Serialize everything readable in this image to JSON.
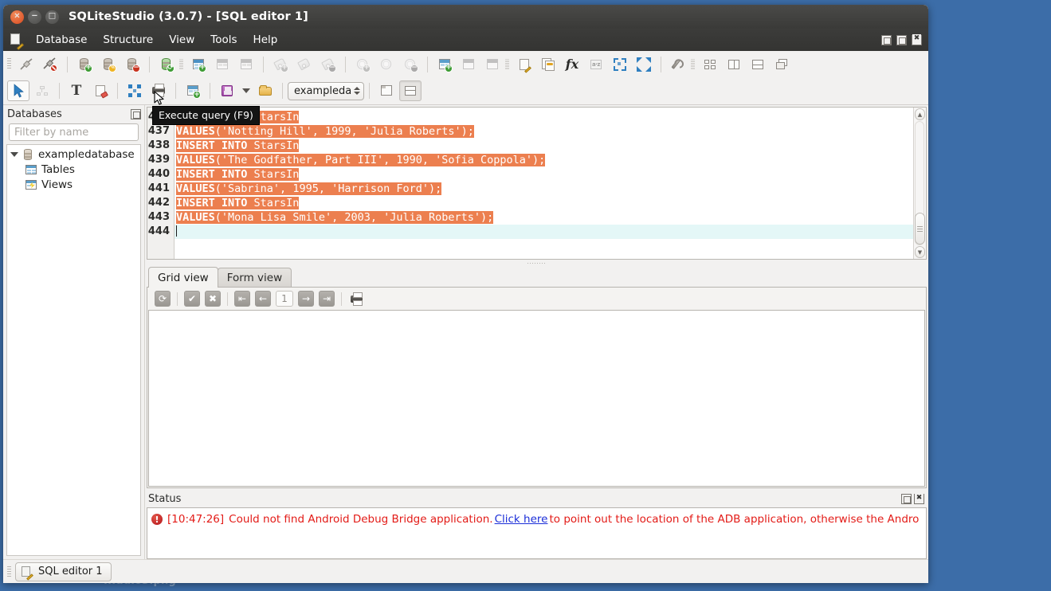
{
  "desktop": {
    "background_color": "#3c6da8",
    "partial_text": "...udio3.png"
  },
  "window": {
    "title": "SQLiteStudio (3.0.7) - [SQL editor 1]",
    "controls": {
      "close": "×",
      "minimize": "−",
      "maximize": "□"
    }
  },
  "menubar": {
    "app_icon": "sql-editor-icon",
    "items": [
      {
        "label": "Database"
      },
      {
        "label": "Structure"
      },
      {
        "label": "View"
      },
      {
        "label": "Tools"
      },
      {
        "label": "Help"
      }
    ]
  },
  "mdi_controls": {
    "minimize": "minimize-icon",
    "restore": "restore-icon",
    "close": "close-icon"
  },
  "toolbar_main": [
    {
      "name": "connect-database",
      "icon": "plug-icon"
    },
    {
      "name": "disconnect-database",
      "icon": "plug-disconnect-icon"
    },
    {
      "name": "add-database",
      "icon": "database-add-icon"
    },
    {
      "name": "edit-database",
      "icon": "database-edit-icon"
    },
    {
      "name": "remove-database",
      "icon": "database-remove-icon"
    },
    {
      "name": "refresh-database",
      "icon": "database-refresh-icon"
    },
    {
      "name": "create-table",
      "icon": "table-add-icon"
    },
    {
      "name": "edit-table",
      "icon": "table-edit-icon"
    },
    {
      "name": "delete-table",
      "icon": "table-remove-icon"
    },
    {
      "name": "create-index",
      "icon": "index-add-icon"
    },
    {
      "name": "edit-index",
      "icon": "index-edit-icon"
    },
    {
      "name": "delete-index",
      "icon": "index-remove-icon"
    },
    {
      "name": "create-trigger",
      "icon": "trigger-add-icon"
    },
    {
      "name": "edit-trigger",
      "icon": "trigger-edit-icon"
    },
    {
      "name": "delete-trigger",
      "icon": "trigger-remove-icon"
    },
    {
      "name": "create-view",
      "icon": "view-add-icon"
    },
    {
      "name": "edit-view",
      "icon": "view-edit-icon"
    },
    {
      "name": "delete-view",
      "icon": "view-remove-icon"
    },
    {
      "name": "open-sql-editor",
      "icon": "sql-editor-icon"
    },
    {
      "name": "open-ddl-history",
      "icon": "ddl-history-icon"
    },
    {
      "name": "open-function-editor",
      "icon": "function-fx-icon"
    },
    {
      "name": "open-collation-editor",
      "icon": "collation-az-icon"
    },
    {
      "name": "import-data",
      "icon": "arrows-in-icon"
    },
    {
      "name": "export-data",
      "icon": "arrows-out-icon"
    },
    {
      "name": "open-configuration",
      "icon": "wrench-icon"
    },
    {
      "name": "tile-windows",
      "icon": "tile-grid-icon"
    },
    {
      "name": "tile-vertically",
      "icon": "tile-vertical-icon"
    },
    {
      "name": "tile-horizontally",
      "icon": "tile-horizontal-icon"
    },
    {
      "name": "cascade-windows",
      "icon": "cascade-icon"
    }
  ],
  "toolbar_editor": {
    "buttons": [
      {
        "name": "execute-query",
        "icon": "blue-arrow-icon",
        "pressed": true
      },
      {
        "name": "explain-query-plan",
        "icon": "sitemap-icon"
      },
      {
        "name": "format-sql",
        "icon": "text-T-icon"
      },
      {
        "name": "clear-editor",
        "icon": "page-erase-icon"
      },
      {
        "name": "expand-query",
        "icon": "blue-expand-icon"
      },
      {
        "name": "print-results",
        "icon": "printer-icon"
      },
      {
        "name": "export-results",
        "icon": "export-grid-icon"
      },
      {
        "name": "save-sql-file",
        "icon": "floppy-save-icon"
      },
      {
        "name": "save-dropdown",
        "icon": "chevron-down-icon"
      },
      {
        "name": "open-sql-file",
        "icon": "folder-open-icon"
      },
      {
        "name": "results-in-tab",
        "icon": "window-tab-icon"
      },
      {
        "name": "results-below",
        "icon": "window-split-icon",
        "pressed": true
      }
    ],
    "database_selector": {
      "value": "exampleda",
      "name": "database-combobox"
    }
  },
  "tooltip": {
    "text": "Execute query (F9)"
  },
  "sidebar": {
    "title": "Databases",
    "dock_buttons": [
      "float-icon"
    ],
    "filter": {
      "placeholder": "Filter by name",
      "value": ""
    },
    "tree": [
      {
        "label": "exampledatabase",
        "icon": "database-icon",
        "level": 0,
        "expanded": true
      },
      {
        "label": "Tables",
        "icon": "tables-icon",
        "level": 1
      },
      {
        "label": "Views",
        "icon": "views-icon",
        "level": 1
      }
    ]
  },
  "editor": {
    "first_line_number": 436,
    "lines": [
      {
        "n": 436,
        "segments": [
          {
            "t": "INSERT INTO",
            "k": true
          },
          {
            "t": " StarsIn",
            "k": false
          }
        ],
        "selected": true
      },
      {
        "n": 437,
        "segments": [
          {
            "t": "VALUES",
            "k": true
          },
          {
            "t": "('Notting Hill', 1999, 'Julia Roberts');",
            "k": false
          }
        ],
        "selected": true
      },
      {
        "n": 438,
        "segments": [
          {
            "t": "INSERT INTO",
            "k": true
          },
          {
            "t": " StarsIn",
            "k": false
          }
        ],
        "selected": true
      },
      {
        "n": 439,
        "segments": [
          {
            "t": "VALUES",
            "k": true
          },
          {
            "t": "('The Godfather, Part III', 1990, 'Sofia Coppola');",
            "k": false
          }
        ],
        "selected": true
      },
      {
        "n": 440,
        "segments": [
          {
            "t": "INSERT INTO",
            "k": true
          },
          {
            "t": " StarsIn",
            "k": false
          }
        ],
        "selected": true
      },
      {
        "n": 441,
        "segments": [
          {
            "t": "VALUES",
            "k": true
          },
          {
            "t": "('Sabrina', 1995, 'Harrison Ford');",
            "k": false
          }
        ],
        "selected": true
      },
      {
        "n": 442,
        "segments": [
          {
            "t": "INSERT INTO",
            "k": true
          },
          {
            "t": " StarsIn",
            "k": false
          }
        ],
        "selected": true
      },
      {
        "n": 443,
        "segments": [
          {
            "t": "VALUES",
            "k": true
          },
          {
            "t": "('Mona Lisa Smile', 2003, 'Julia Roberts');",
            "k": false
          }
        ],
        "selected": true
      },
      {
        "n": 444,
        "segments": [
          {
            "t": "",
            "k": false
          }
        ],
        "selected": false,
        "current": true
      }
    ],
    "selection_color": "#ec7f4f",
    "current_line_color": "#e4f7f7",
    "keyword_color": "#ffffff"
  },
  "results": {
    "tabs": [
      {
        "label": "Grid view",
        "active": true
      },
      {
        "label": "Form view",
        "active": false
      }
    ],
    "grid_toolbar": [
      {
        "name": "refresh-results-button",
        "icon": "refresh-icon"
      },
      {
        "name": "commit-button",
        "icon": "check-icon"
      },
      {
        "name": "rollback-button",
        "icon": "cross-icon"
      },
      {
        "name": "first-page-button",
        "icon": "first-page-icon"
      },
      {
        "name": "previous-page-button",
        "icon": "previous-page-icon"
      },
      {
        "name": "page-number",
        "icon": "",
        "label": "1"
      },
      {
        "name": "next-page-button",
        "icon": "next-page-icon"
      },
      {
        "name": "last-page-button",
        "icon": "last-page-icon"
      },
      {
        "name": "print-grid-button",
        "icon": "printer-icon"
      }
    ],
    "page_number": "1",
    "rows": []
  },
  "status": {
    "title": "Status",
    "dock_buttons": [
      "float-icon",
      "close-icon"
    ],
    "messages": [
      {
        "level": "error",
        "icon": "error-icon",
        "timestamp": "[10:47:26]",
        "text_before": "Could not find Android Debug Bridge application.",
        "link": "Click here",
        "text_after": "to point out the location of the ADB application, otherwise the Andro"
      }
    ]
  },
  "taskbar": {
    "buttons": [
      {
        "label": "SQL editor 1",
        "icon": "sql-editor-icon",
        "active": true
      }
    ]
  },
  "colors": {
    "window_chrome": "#f2f1f0",
    "titlebar": "#3e3e3c",
    "desktop": "#3c6da8",
    "selection": "#ec7f4f",
    "error_text": "#e31b17",
    "link": "#1b2ed8"
  }
}
